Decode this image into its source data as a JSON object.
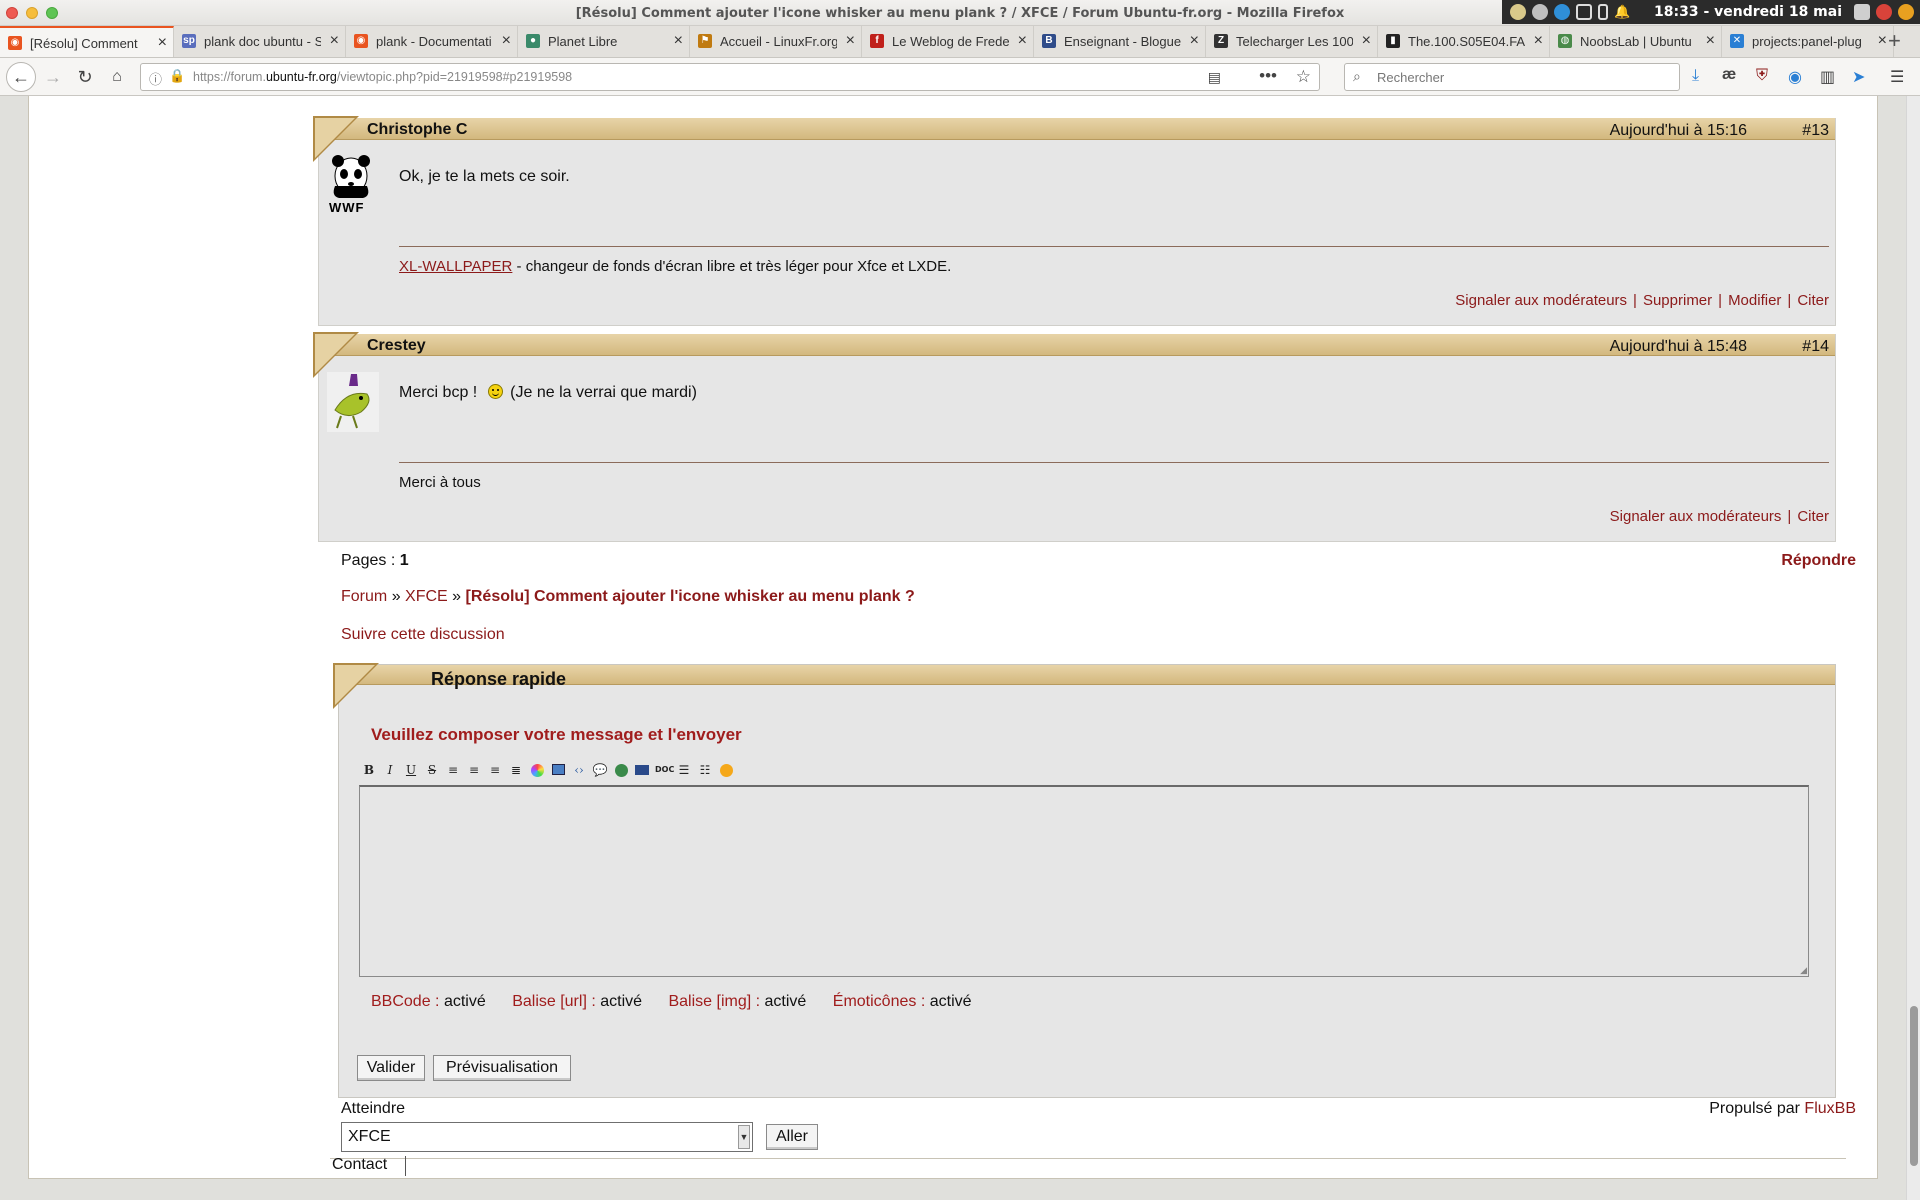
{
  "window": {
    "title": "[Résolu] Comment ajouter l'icone whisker au menu plank ? / XFCE / Forum Ubuntu-fr.org - Mozilla Firefox",
    "clock": "18:33 - vendredi 18 mai"
  },
  "tabs": [
    {
      "label": "[Résolu] Comment",
      "icon": "ubuntu-icon",
      "color": "#e95420",
      "glyph": "◉"
    },
    {
      "label": "plank doc ubuntu - S",
      "icon": "sp-icon",
      "color": "#5a6ebd",
      "glyph": "sp"
    },
    {
      "label": "plank - Documentati",
      "icon": "ubuntu-icon",
      "color": "#e95420",
      "glyph": "◉"
    },
    {
      "label": "Planet Libre",
      "icon": "planet-icon",
      "color": "#3a8a6a",
      "glyph": "●"
    },
    {
      "label": "Accueil - LinuxFr.org",
      "icon": "linuxfr-icon",
      "color": "#c07a10",
      "glyph": "⚑"
    },
    {
      "label": "Le Weblog de Frede",
      "icon": "weblog-icon",
      "color": "#c0201a",
      "glyph": "f"
    },
    {
      "label": "Enseignant - Blogue",
      "icon": "blog-icon",
      "color": "#2f4c8a",
      "glyph": "B"
    },
    {
      "label": "Telecharger Les 100",
      "icon": "download-site-icon",
      "color": "#333333",
      "glyph": "Z"
    },
    {
      "label": "The.100.S05E04.FA",
      "icon": "imdb-icon",
      "color": "#222222",
      "glyph": "▮"
    },
    {
      "label": "NoobsLab | Ubuntu",
      "icon": "noobslab-icon",
      "color": "#4a8a4a",
      "glyph": "◍"
    },
    {
      "label": "projects:panel-plug",
      "icon": "xfce-icon",
      "color": "#2a7fd4",
      "glyph": "✕"
    }
  ],
  "navbar": {
    "url_prefix": "https://forum.",
    "url_domain": "ubuntu-fr.org",
    "url_path": "/viewtopic.php?pid=21919598#p21919598",
    "search_placeholder": "Rechercher"
  },
  "posts": [
    {
      "author": "Christophe C",
      "date": "Aujourd'hui à 15:16",
      "num": "#13",
      "message": "Ok, je te la mets ce soir.",
      "signature_link": "XL-WALLPAPER",
      "signature_text": " - changeur de fonds d'écran libre et très léger pour Xfce et LXDE.",
      "actions": [
        "Signaler aux modérateurs",
        "Supprimer",
        "Modifier",
        "Citer"
      ],
      "avatar_text": "WWF"
    },
    {
      "author": "Crestey",
      "date": "Aujourd'hui à 15:48",
      "num": "#14",
      "message_a": "Merci bcp !",
      "message_b": "(Je ne la verrai que mardi)",
      "signature_text": "Merci à tous",
      "actions": [
        "Signaler aux modérateurs",
        "Citer"
      ]
    }
  ],
  "pages": {
    "label": "Pages : ",
    "current": "1"
  },
  "reply_link": "Répondre",
  "breadcrumb": {
    "forum": "Forum",
    "sep": "»",
    "category": "XFCE",
    "topic": "[Résolu] Comment ajouter l'icone whisker au menu plank ?"
  },
  "follow": "Suivre cette discussion",
  "quick_reply": {
    "title": "Réponse rapide",
    "prompt": "Veuillez composer votre message et l'envoyer",
    "status": [
      {
        "key": "BBCode :",
        "value": "activé"
      },
      {
        "key": "Balise [url] :",
        "value": "activé"
      },
      {
        "key": "Balise [img] :",
        "value": "activé"
      },
      {
        "key": "Émoticônes :",
        "value": "activé"
      }
    ],
    "submit": "Valider",
    "preview": "Prévisualisation"
  },
  "jump": {
    "label": "Atteindre",
    "selected": "XFCE",
    "go": "Aller"
  },
  "powered": {
    "text": "Propulsé par ",
    "link": "FluxBB"
  },
  "footer": {
    "contact": "Contact"
  }
}
